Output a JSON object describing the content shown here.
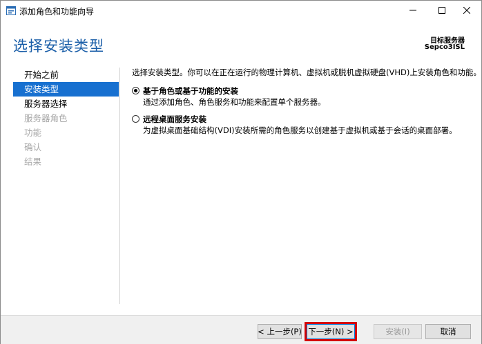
{
  "window": {
    "title": "添加角色和功能向导",
    "controls": {
      "minimize": "—",
      "maximize": "☐",
      "close": "✕"
    }
  },
  "header": {
    "page_title": "选择安装类型",
    "destination_label": "目标服务器",
    "destination_server": "Sepco3ISL"
  },
  "nav": {
    "items": [
      {
        "label": "开始之前",
        "state": "normal"
      },
      {
        "label": "安装类型",
        "state": "active"
      },
      {
        "label": "服务器选择",
        "state": "normal"
      },
      {
        "label": "服务器角色",
        "state": "disabled"
      },
      {
        "label": "功能",
        "state": "disabled"
      },
      {
        "label": "确认",
        "state": "disabled"
      },
      {
        "label": "结果",
        "state": "disabled"
      }
    ]
  },
  "content": {
    "intro": "选择安装类型。你可以在正在运行的物理计算机、虚拟机或脱机虚拟硬盘(VHD)上安装角色和功能。",
    "options": [
      {
        "title": "基于角色或基于功能的安装",
        "description": "通过添加角色、角色服务和功能来配置单个服务器。",
        "selected": true
      },
      {
        "title": "远程桌面服务安装",
        "description": "为虚拟桌面基础结构(VDI)安装所需的角色服务以创建基于虚拟机或基于会话的桌面部署。",
        "selected": false
      }
    ]
  },
  "footer": {
    "prev_label": "< 上一步(P)",
    "next_label": "下一步(N) >",
    "install_label": "安装(I)",
    "cancel_label": "取消"
  },
  "colors": {
    "accent": "#1770d0",
    "title_blue": "#1a5ea8",
    "highlight_box": "#d40000"
  }
}
